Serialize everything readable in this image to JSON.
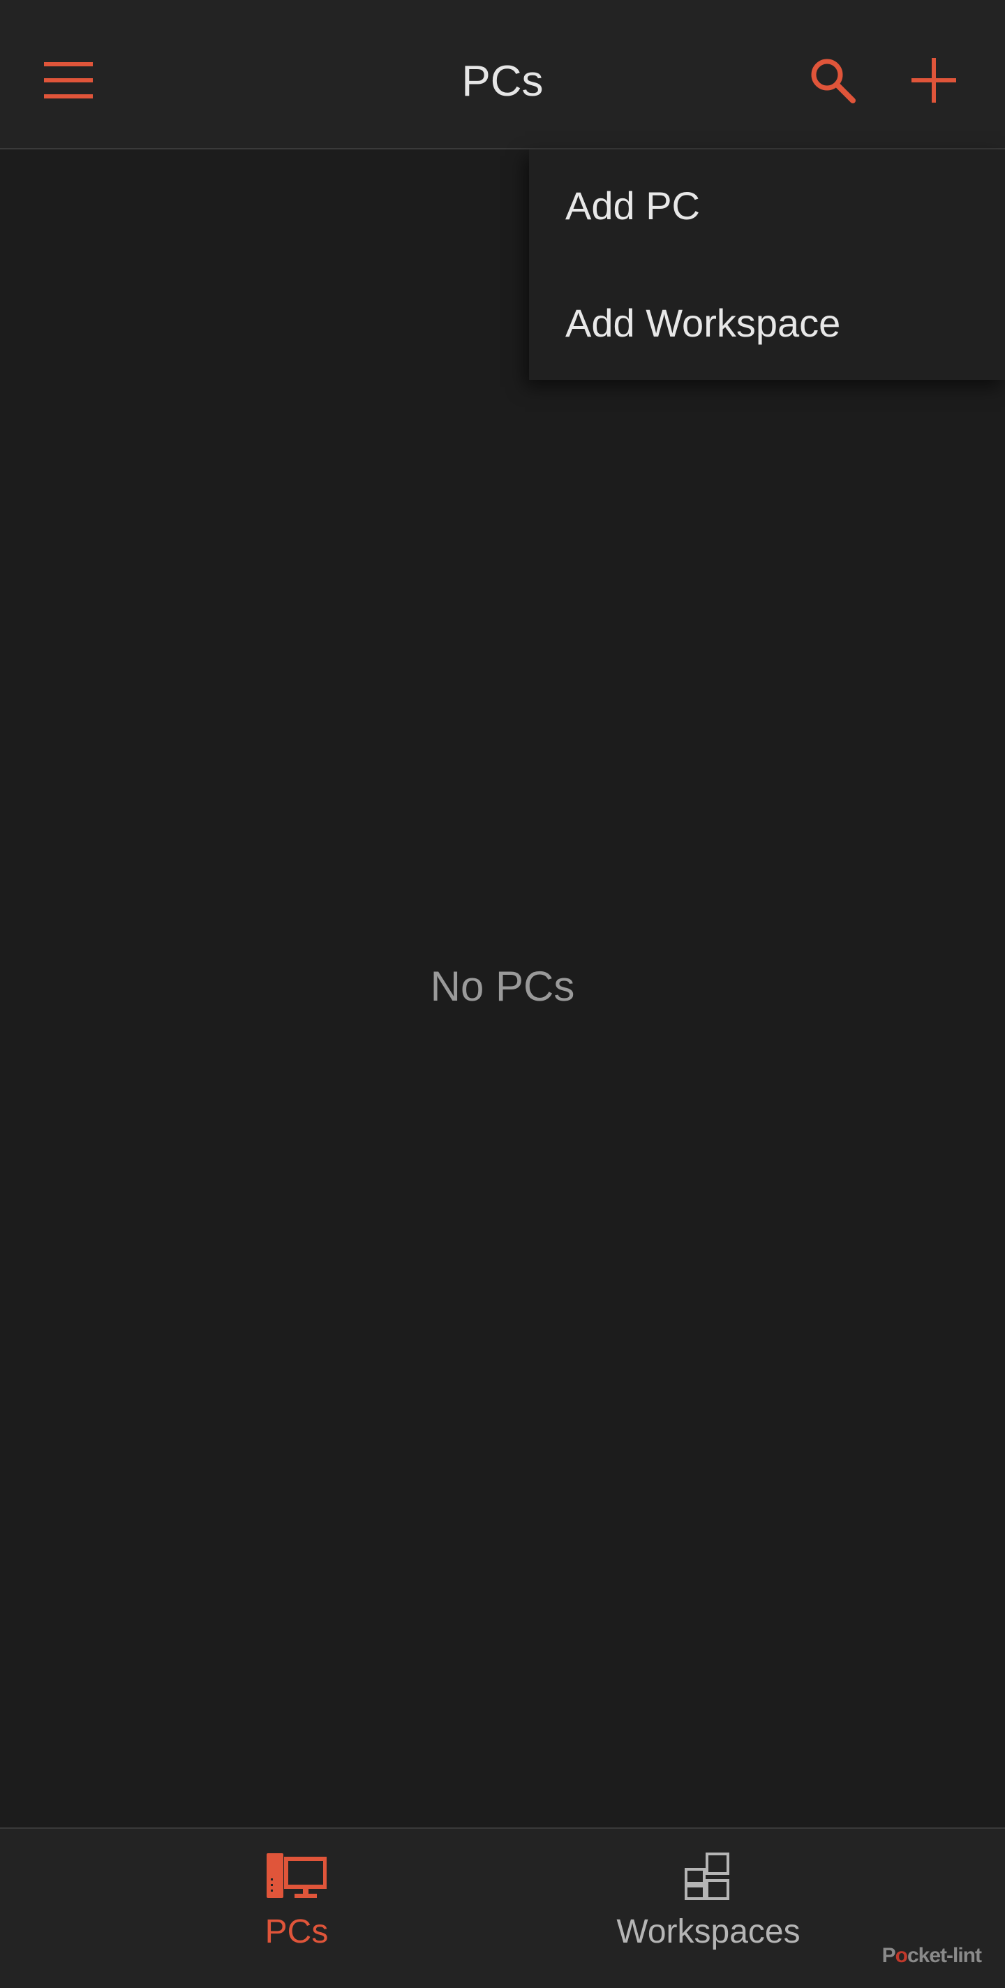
{
  "app_bar": {
    "title": "PCs",
    "menu_icon": "hamburger-menu-icon",
    "search_icon": "search-icon",
    "add_icon": "plus-icon"
  },
  "dropdown": {
    "items": [
      {
        "label": "Add PC"
      },
      {
        "label": "Add Workspace"
      }
    ]
  },
  "empty_state": {
    "message": "No PCs"
  },
  "bottom_nav": {
    "tabs": [
      {
        "label": "PCs",
        "icon": "desktop-pc-icon",
        "active": true
      },
      {
        "label": "Workspaces",
        "icon": "workspaces-grid-icon",
        "active": false
      }
    ]
  },
  "watermark": {
    "text": "Pocket-lint"
  },
  "colors": {
    "accent": "#e0553a",
    "background": "#1c1c1c",
    "bar_background": "#232323",
    "text_primary": "#e6e6e6",
    "text_secondary": "#9a9a9a"
  }
}
